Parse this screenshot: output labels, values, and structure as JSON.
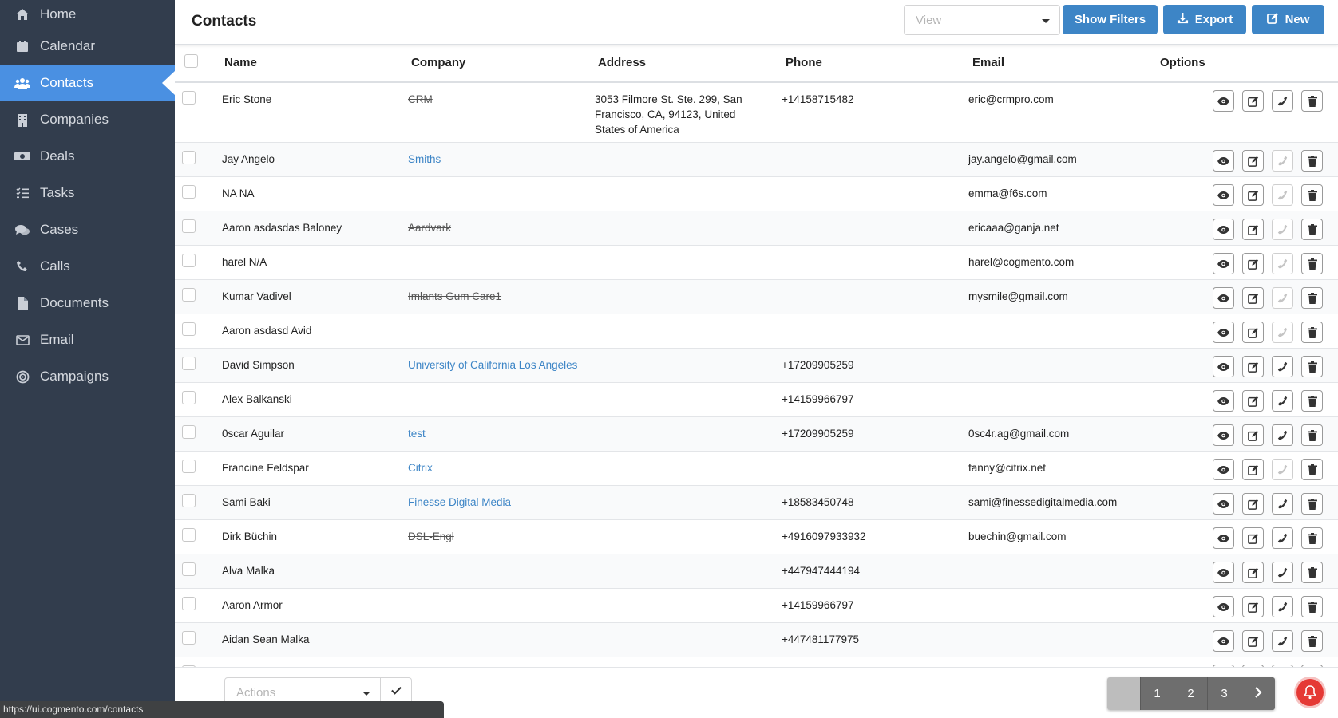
{
  "sidebar": {
    "items": [
      {
        "label": "Home",
        "icon": "home-icon"
      },
      {
        "label": "Calendar",
        "icon": "calendar-icon"
      },
      {
        "label": "Contacts",
        "icon": "users-icon"
      },
      {
        "label": "Companies",
        "icon": "building-icon"
      },
      {
        "label": "Deals",
        "icon": "money-icon"
      },
      {
        "label": "Tasks",
        "icon": "tasks-icon"
      },
      {
        "label": "Cases",
        "icon": "comments-icon"
      },
      {
        "label": "Calls",
        "icon": "phone-icon"
      },
      {
        "label": "Documents",
        "icon": "file-icon"
      },
      {
        "label": "Email",
        "icon": "envelope-icon"
      },
      {
        "label": "Campaigns",
        "icon": "bullseye-icon"
      }
    ],
    "active": "Contacts"
  },
  "header": {
    "title": "Contacts",
    "view_placeholder": "View",
    "show_filters": "Show Filters",
    "export": "Export",
    "new": "New",
    "accent": "#3d85c6"
  },
  "table": {
    "columns": {
      "name": "Name",
      "company": "Company",
      "address": "Address",
      "phone": "Phone",
      "email": "Email",
      "options": "Options"
    },
    "rows": [
      {
        "name": "Eric Stone",
        "company": "CRM",
        "company_struck": true,
        "address": "3053 Filmore St. Ste. 299, San Francisco, CA, 94123, United States of America",
        "phone": "+14158715482",
        "email": "eric@crmpro.com",
        "call_enabled": true
      },
      {
        "name": "Jay Angelo",
        "company": "Smiths",
        "company_struck": false,
        "address": "",
        "phone": "",
        "email": "jay.angelo@gmail.com",
        "call_enabled": false
      },
      {
        "name": "NA NA",
        "company": "",
        "company_struck": false,
        "address": "",
        "phone": "",
        "email": "emma@f6s.com",
        "call_enabled": false
      },
      {
        "name": "Aaron asdasdas Baloney",
        "company": "Aardvark",
        "company_struck": true,
        "address": "",
        "phone": "",
        "email": "ericaaa@ganja.net",
        "call_enabled": false
      },
      {
        "name": "harel N/A",
        "company": "",
        "company_struck": false,
        "address": "",
        "phone": "",
        "email": "harel@cogmento.com",
        "call_enabled": false
      },
      {
        "name": "Kumar Vadivel",
        "company": "Imlants Gum Care1",
        "company_struck": true,
        "address": "",
        "phone": "",
        "email": "mysmile@gmail.com",
        "call_enabled": false
      },
      {
        "name": "Aaron asdasd Avid",
        "company": "",
        "company_struck": false,
        "address": "",
        "phone": "",
        "email": "",
        "call_enabled": false
      },
      {
        "name": "David Simpson",
        "company": "University of California Los Angeles",
        "company_struck": false,
        "address": "",
        "phone": "+17209905259",
        "email": "",
        "call_enabled": true
      },
      {
        "name": "Alex Balkanski",
        "company": "",
        "company_struck": false,
        "address": "",
        "phone": "+14159966797",
        "email": "",
        "call_enabled": true
      },
      {
        "name": "0scar Aguilar",
        "company": "test",
        "company_struck": false,
        "address": "",
        "phone": "+17209905259",
        "email": "0sc4r.ag@gmail.com",
        "call_enabled": true
      },
      {
        "name": "Francine Feldspar",
        "company": "Citrix",
        "company_struck": false,
        "address": "",
        "phone": "",
        "email": "fanny@citrix.net",
        "call_enabled": false
      },
      {
        "name": "Sami Baki",
        "company": "Finesse Digital Media",
        "company_struck": false,
        "address": "",
        "phone": "+18583450748",
        "email": "sami@finessedigitalmedia.com",
        "call_enabled": true
      },
      {
        "name": "Dirk Büchin",
        "company": "DSL-Engl",
        "company_struck": true,
        "address": "",
        "phone": "+4916097933932",
        "email": "buechin@gmail.com",
        "call_enabled": true
      },
      {
        "name": "Alva Malka",
        "company": "",
        "company_struck": false,
        "address": "",
        "phone": "+447947444194",
        "email": "",
        "call_enabled": true
      },
      {
        "name": "Aaron Armor",
        "company": "",
        "company_struck": false,
        "address": "",
        "phone": "+14159966797",
        "email": "",
        "call_enabled": true
      },
      {
        "name": "Aidan Sean Malka",
        "company": "",
        "company_struck": false,
        "address": "",
        "phone": "+447481177975",
        "email": "",
        "call_enabled": true
      },
      {
        "name": "",
        "company": "",
        "company_struck": false,
        "address": "",
        "phone": "",
        "email": "",
        "call_enabled": true
      }
    ]
  },
  "footer": {
    "actions_placeholder": "Actions",
    "pages": [
      "1",
      "2",
      "3"
    ]
  },
  "status_url": "https://ui.cogmento.com/contacts"
}
